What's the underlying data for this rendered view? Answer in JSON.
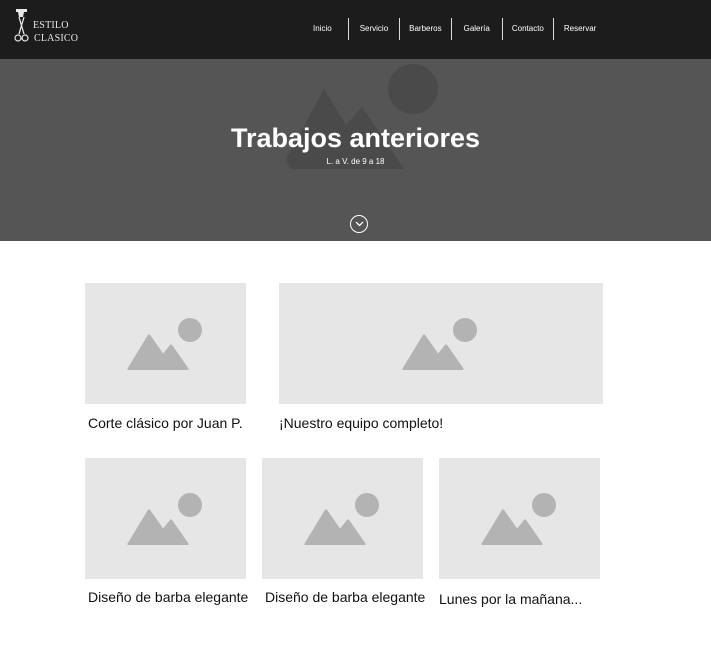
{
  "header": {
    "logo": {
      "line1": "ESTILO",
      "line2": "CLASICO"
    },
    "nav": [
      "Inicio",
      "Servicio",
      "Barberos",
      "Galería",
      "Contacto",
      "Reservar"
    ]
  },
  "hero": {
    "title": "Trabajos anteriores",
    "hours": "L. a V. de 9 a 18"
  },
  "gallery": [
    {
      "caption": "Corte clásico por Juan P."
    },
    {
      "caption": "¡Nuestro equipo completo!"
    },
    {
      "caption": "Diseño de barba elegante"
    },
    {
      "caption": "Diseño de barba elegante"
    },
    {
      "caption": "Lunes por la mañana..."
    }
  ],
  "colors": {
    "header_bg": "#1c1c1c",
    "hero_bg": "#555555",
    "placeholder_bg": "#e6e6e6",
    "placeholder_icon": "#b3b3b3"
  }
}
